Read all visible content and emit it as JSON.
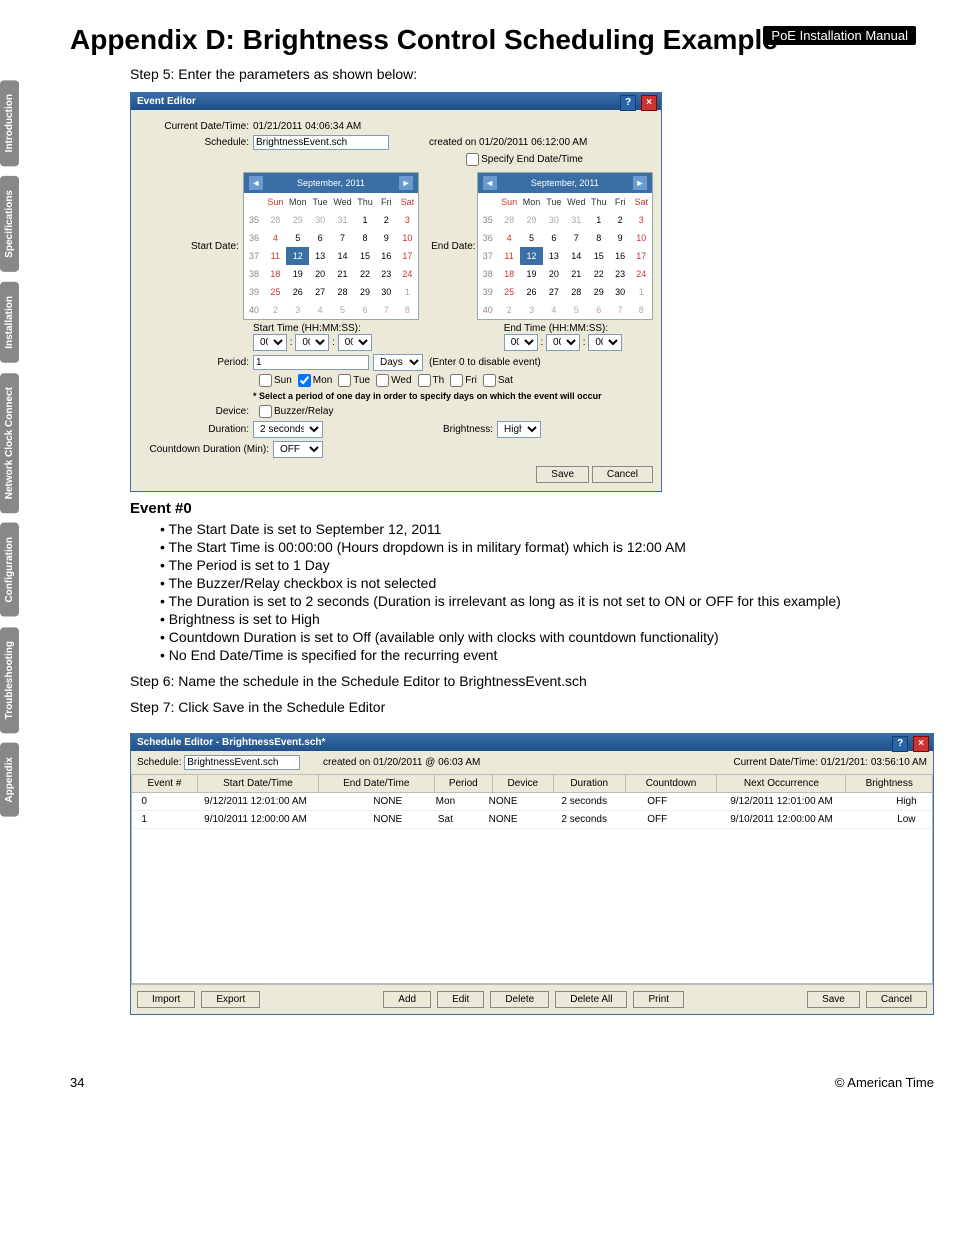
{
  "badge": "PoE Installation Manual",
  "title": "Appendix D: Brightness Control Scheduling Example",
  "tabs": [
    "Introduction",
    "Specifications",
    "Installation",
    "Network Clock Connect",
    "Configuration",
    "Troubleshooting",
    "Appendix"
  ],
  "step5": "Step 5: Enter the parameters as shown below:",
  "eventEditor": {
    "title": "Event Editor",
    "currentLabel": "Current Date/Time:",
    "currentValue": "01/21/2011 04:06:34 AM",
    "scheduleLabel": "Schedule:",
    "scheduleValue": "BrightnessEvent.sch",
    "createdOn": "created on  01/20/2011 06:12:00 AM",
    "specifyEnd": "Specify End Date/Time",
    "startDateLabel": "Start Date:",
    "endDateLabel": "End Date:",
    "calMonth": "September,  2011",
    "dow": [
      "Sun",
      "Mon",
      "Tue",
      "Wed",
      "Thu",
      "Fri",
      "Sat"
    ],
    "weeks": [
      {
        "wk": 35,
        "d": [
          "28",
          "29",
          "30",
          "31",
          "1",
          "2",
          "3"
        ],
        "dim": [
          0,
          1,
          2,
          3
        ]
      },
      {
        "wk": 36,
        "d": [
          "4",
          "5",
          "6",
          "7",
          "8",
          "9",
          "10"
        ]
      },
      {
        "wk": 37,
        "d": [
          "11",
          "12",
          "13",
          "14",
          "15",
          "16",
          "17"
        ],
        "seli": 1
      },
      {
        "wk": 38,
        "d": [
          "18",
          "19",
          "20",
          "21",
          "22",
          "23",
          "24"
        ]
      },
      {
        "wk": 39,
        "d": [
          "25",
          "26",
          "27",
          "28",
          "29",
          "30",
          "1"
        ],
        "dim": [
          6
        ]
      },
      {
        "wk": 40,
        "d": [
          "2",
          "3",
          "4",
          "5",
          "6",
          "7",
          "8"
        ],
        "dim": [
          0,
          1,
          2,
          3,
          4,
          5,
          6
        ]
      }
    ],
    "startTimeLabel": "Start Time (HH:MM:SS):",
    "endTimeLabel": "End Time (HH:MM:SS):",
    "time": [
      "00",
      "00",
      "00"
    ],
    "periodLabel": "Period:",
    "periodValue": "1",
    "periodUnit": "Days",
    "periodHint": "(Enter 0 to disable event)",
    "days": [
      "Sun",
      "Mon",
      "Tue",
      "Wed",
      "Th",
      "Fri",
      "Sat"
    ],
    "dayChecked": [
      false,
      true,
      false,
      false,
      false,
      false,
      false
    ],
    "dayNote": "* Select a period of one day in order to specify days on which the event will occur",
    "deviceLabel": "Device:",
    "deviceOption": "Buzzer/Relay",
    "durationLabel": "Duration:",
    "durationValue": "2 seconds",
    "brightnessLabel": "Brightness:",
    "brightnessValue": "High",
    "countdownLabel": "Countdown Duration (Min):",
    "countdownValue": "OFF",
    "save": "Save",
    "cancel": "Cancel"
  },
  "event0": {
    "title": "Event #0",
    "bullets": [
      "The Start Date is set to September 12, 2011",
      "The Start Time is 00:00:00 (Hours dropdown is in military format) which is 12:00 AM",
      "The Period is set to 1 Day",
      "The Buzzer/Relay checkbox is not selected",
      "The Duration is set to 2 seconds (Duration is irrelevant as long as it is not set to ON or OFF for this example)",
      "Brightness is set to High",
      "Countdown Duration is set to Off (available only with clocks with countdown functionality)",
      "No End Date/Time is specified for the recurring event"
    ]
  },
  "step6": "Step 6: Name the schedule in the Schedule Editor to BrightnessEvent.sch",
  "step7": "Step 7: Click Save in the Schedule Editor",
  "schedule": {
    "title": "Schedule Editor - BrightnessEvent.sch*",
    "scheduleLabel": "Schedule:",
    "scheduleValue": "BrightnessEvent.sch",
    "createdOn": "created on  01/20/2011 @ 06:03 AM",
    "currentLabel": "Current Date/Time:  01/21/201: 03:56:10 AM",
    "cols": [
      "Event #",
      "Start Date/Time",
      "End Date/Time",
      "Period",
      "Device",
      "Duration",
      "Countdown",
      "Next Occurrence",
      "Brightness"
    ],
    "rows": [
      [
        "0",
        "9/12/2011 12:01:00 AM",
        "NONE",
        "Mon",
        "NONE",
        "2 seconds",
        "OFF",
        "9/12/2011 12:01:00 AM",
        "High"
      ],
      [
        "1",
        "9/10/2011 12:00:00 AM",
        "NONE",
        "Sat",
        "NONE",
        "2 seconds",
        "OFF",
        "9/10/2011 12:00:00 AM",
        "Low"
      ]
    ],
    "buttons": {
      "import": "Import",
      "export": "Export",
      "add": "Add",
      "edit": "Edit",
      "delete": "Delete",
      "deleteAll": "Delete All",
      "print": "Print",
      "save": "Save",
      "cancel": "Cancel"
    }
  },
  "pageNum": "34",
  "copyright": "© American Time"
}
